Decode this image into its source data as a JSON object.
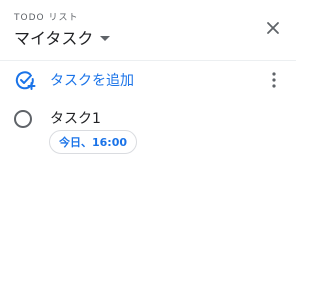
{
  "header": {
    "subtitle": "TODO リスト",
    "list_title": "マイタスク"
  },
  "toolbar": {
    "add_label": "タスクを追加"
  },
  "tasks": [
    {
      "title": "タスク1",
      "due": "今日、16:00",
      "completed": false
    }
  ],
  "colors": {
    "accent": "#1a73e8",
    "text": "#202124",
    "muted": "#5f6368",
    "border": "#dadce0"
  },
  "icons": {
    "close": "close-icon",
    "dropdown": "arrow-drop-down-icon",
    "add_task": "add-task-icon",
    "more": "more-vert-icon",
    "checkbox": "radio-unchecked-icon"
  }
}
